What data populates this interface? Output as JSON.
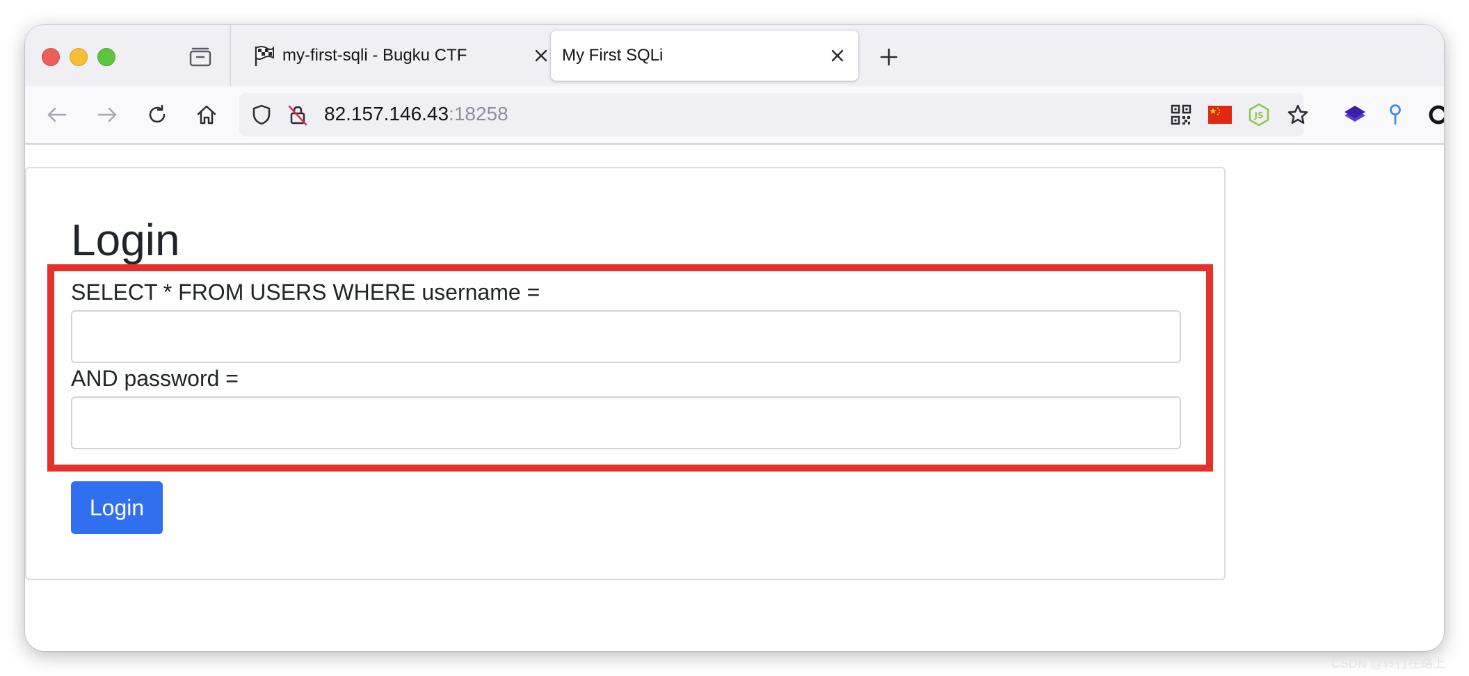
{
  "browser": {
    "tabs": [
      {
        "title": "my-first-sqli - Bugku CTF",
        "favicon": "checkered-flag-icon",
        "active": false
      },
      {
        "title": "My First SQLi",
        "favicon": "",
        "active": true
      }
    ],
    "url": {
      "host": "82.157.146.43",
      "port": ":18258"
    },
    "extensions": [
      "qr-code-icon",
      "china-flag-icon",
      "nodejs-icon",
      "bookmark-star-icon",
      "layers-icon",
      "pin-icon",
      "circle-icon"
    ],
    "colors": {
      "flag_red": "#de2910",
      "flag_yellow": "#ffde00",
      "node_green": "#8cc84b",
      "layers_purple": "#3b1fa6",
      "pin_blue": "#3d8bf2"
    }
  },
  "page": {
    "title": "Login",
    "username_label": "SELECT * FROM USERS WHERE username =",
    "username_value": "",
    "password_label": "AND password =",
    "password_value": "",
    "submit_label": "Login",
    "colors": {
      "button": "#2f6ff0",
      "highlight_border": "#e6302a"
    }
  },
  "watermark": "CSDN @转行在路上"
}
